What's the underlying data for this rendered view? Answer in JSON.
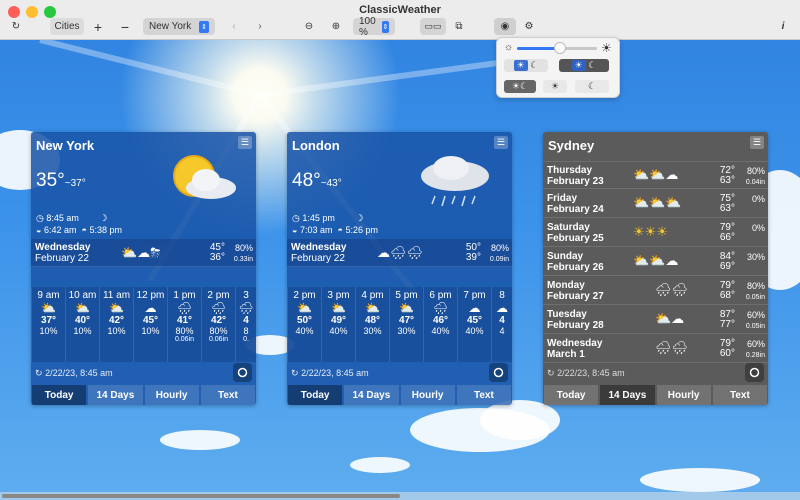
{
  "window": {
    "title": "ClassicWeather"
  },
  "toolbar": {
    "cities_label": "Cities",
    "add_label": "+",
    "remove_label": "−",
    "city_select": "New York",
    "zoom_value": "100 %",
    "info_label": "i"
  },
  "colors": {
    "accent": "#1b63c6",
    "card_blue": "#1854a8",
    "card_gray": "#5b5b5b"
  },
  "cities": [
    {
      "name": "New York",
      "temp": "35°",
      "feels": "~37°",
      "time": "8:45 am",
      "sunrise": "6:42 am",
      "sunset": "5:38 pm",
      "day": {
        "name": "Wednesday",
        "date": "February 22",
        "hi": "45°",
        "lo": "36°",
        "pct": "80%",
        "amt": "0.33in"
      },
      "hours": [
        {
          "time": "9 am",
          "temp": "37°",
          "pct": "10%",
          "amt": "",
          "wind": "2"
        },
        {
          "time": "10 am",
          "temp": "40°",
          "pct": "10%",
          "amt": "",
          "wind": "2"
        },
        {
          "time": "11 am",
          "temp": "42°",
          "pct": "10%",
          "amt": "",
          "wind": "2"
        },
        {
          "time": "12 pm",
          "temp": "45°",
          "pct": "10%",
          "amt": "",
          "wind": "1"
        },
        {
          "time": "1 pm",
          "temp": "41°",
          "pct": "80%",
          "amt": "0.06in",
          "wind": "1"
        },
        {
          "time": "2 pm",
          "temp": "42°",
          "pct": "80%",
          "amt": "0.06in",
          "wind": "1"
        },
        {
          "time": "3",
          "temp": "4",
          "pct": "8",
          "amt": "0.",
          "wind": ""
        }
      ],
      "updated": "2/22/23, 8:45 am"
    },
    {
      "name": "London",
      "temp": "48°",
      "feels": "~43°",
      "time": "1:45 pm",
      "sunrise": "7:03 am",
      "sunset": "5:26 pm",
      "day": {
        "name": "Wednesday",
        "date": "February 22",
        "hi": "50°",
        "lo": "39°",
        "pct": "80%",
        "amt": "0.09in"
      },
      "hours": [
        {
          "time": "2 pm",
          "temp": "50°",
          "pct": "40%",
          "amt": "",
          "wind": ""
        },
        {
          "time": "3 pm",
          "temp": "49°",
          "pct": "40%",
          "amt": "",
          "wind": "1"
        },
        {
          "time": "4 pm",
          "temp": "48°",
          "pct": "30%",
          "amt": "",
          "wind": ""
        },
        {
          "time": "5 pm",
          "temp": "47°",
          "pct": "30%",
          "amt": "",
          "wind": ""
        },
        {
          "time": "6 pm",
          "temp": "46°",
          "pct": "40%",
          "amt": "",
          "wind": ""
        },
        {
          "time": "7 pm",
          "temp": "45°",
          "pct": "40%",
          "amt": "",
          "wind": ""
        },
        {
          "time": "8",
          "temp": "4",
          "pct": "4",
          "amt": "",
          "wind": ""
        }
      ],
      "updated": "2/22/23, 8:45 am"
    },
    {
      "name": "Sydney",
      "days": [
        {
          "name": "Thursday",
          "date": "February 23",
          "hi": "72°",
          "lo": "63°",
          "pct": "80%",
          "amt": "0.04in"
        },
        {
          "name": "Friday",
          "date": "February 24",
          "hi": "75°",
          "lo": "63°",
          "pct": "0%",
          "amt": ""
        },
        {
          "name": "Saturday",
          "date": "February 25",
          "hi": "79°",
          "lo": "66°",
          "pct": "0%",
          "amt": ""
        },
        {
          "name": "Sunday",
          "date": "February 26",
          "hi": "84°",
          "lo": "69°",
          "pct": "30%",
          "amt": ""
        },
        {
          "name": "Monday",
          "date": "February 27",
          "hi": "79°",
          "lo": "68°",
          "pct": "80%",
          "amt": "0.05in"
        },
        {
          "name": "Tuesday",
          "date": "February 28",
          "hi": "87°",
          "lo": "77°",
          "pct": "60%",
          "amt": "0.05in"
        },
        {
          "name": "Wednesday",
          "date": "March 1",
          "hi": "79°",
          "lo": "60°",
          "pct": "60%",
          "amt": "0.28in"
        }
      ],
      "updated": "2/22/23, 8:45 am"
    }
  ],
  "tabs": {
    "today": "Today",
    "days14": "14 Days",
    "hourly": "Hourly",
    "text": "Text"
  }
}
